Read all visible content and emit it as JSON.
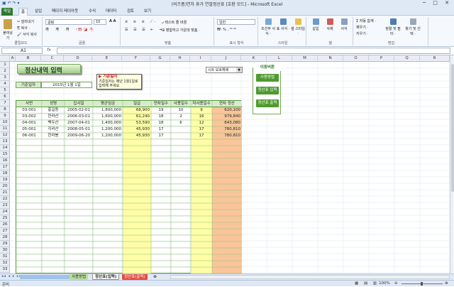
{
  "window": {
    "title": "(비즈폼)연차 휴가 연말정산표  [호환 모드]  -  Microsoft Excel",
    "controls": "─ □ ✕"
  },
  "tabs": [
    {
      "label": "파일"
    },
    {
      "label": "홈"
    },
    {
      "label": "삽입"
    },
    {
      "label": "페이지 레이아웃"
    },
    {
      "label": "수식"
    },
    {
      "label": "데이터"
    },
    {
      "label": "검토"
    },
    {
      "label": "보기"
    }
  ],
  "ribbon": {
    "clipboard": {
      "paste": "붙여넣기",
      "cut": "잘라내기",
      "copy": "복사 ·",
      "format_painter": "서식 복사",
      "label": "클립보드"
    },
    "font": {
      "name": "굴림",
      "size": "10",
      "label": "글꼴"
    },
    "align": {
      "wrap": "텍스트 줄 바꿈",
      "merge": "병합하고 가운데 맞춤 ·",
      "label": "맞춤"
    },
    "number": {
      "format": "일반",
      "label": "표시 형식"
    },
    "styles": {
      "cond": "조건부 서식 ·",
      "table": "표 서식 ·",
      "cell": "셀 스타일 ·",
      "label": "스타일"
    },
    "cells": {
      "insert": "삽입",
      "delete": "삭제",
      "format": "서식",
      "label": "셀"
    },
    "edit": {
      "autosum": "Σ 자동 합계 ·",
      "fill": "채우기 ·",
      "clear": "지우기 ·",
      "sort": "정렬 및 필터 ·",
      "find": "찾기 및 선택 ·",
      "label": "편집"
    }
  },
  "formula_bar": {
    "cell": "A1",
    "fx": "fx",
    "value": ""
  },
  "columns": [
    "A",
    "B",
    "C",
    "D",
    "E",
    "F",
    "G",
    "H",
    "I",
    "J",
    "K",
    "L",
    "M",
    "N",
    "O",
    "P",
    "Q",
    "R"
  ],
  "rows": [
    "1",
    "2",
    "3",
    "4",
    "5",
    "6",
    "7",
    "8",
    "9",
    "10",
    "11",
    "12",
    "13",
    "14",
    "15",
    "16",
    "17",
    "18",
    "19",
    "20",
    "21",
    "22",
    "23",
    "24",
    "25",
    "26",
    "27",
    "28",
    "29",
    "30",
    "31",
    "32",
    "33"
  ],
  "sheet": {
    "title": "정산내역 입력",
    "base_date_label": "기준일자",
    "base_date_value": "2015년 1월 1일",
    "comment_title": "▶ 기준일자",
    "comment_body": "기준일자는 매년 1월1일로 입력해 주세요.",
    "dropdown": "시트 보호해제",
    "panel": {
      "title": "이동버튼",
      "btn1": "사용방법",
      "btn2": "정산표 입력",
      "btn3": "정산표 출력"
    },
    "headers": [
      "사번",
      "성명",
      "입사일",
      "평균임금",
      "일급",
      "연차일수",
      "사용일수",
      "미사용일수",
      "연차 정산"
    ],
    "records": [
      [
        "03-001",
        "홍길동",
        "2005-02-01",
        "1,800,000",
        "68,900",
        "19",
        "10",
        "9",
        "620,100"
      ],
      [
        "03-002",
        "한라산",
        "2006-03-01",
        "1,600,000",
        "61,240",
        "18",
        "2",
        "16",
        "979,840"
      ],
      [
        "04-001",
        "백두산",
        "2007-04-01",
        "1,400,000",
        "53,590",
        "18",
        "6",
        "12",
        "643,080"
      ],
      [
        "05-001",
        "지리산",
        "2008-05-01",
        "1,200,000",
        "45,930",
        "17",
        "",
        "17",
        "780,810"
      ],
      [
        "06-001",
        "한라봉",
        "2009-06-20",
        "1,200,000",
        "45,930",
        "17",
        "",
        "17",
        "780,810"
      ]
    ]
  },
  "sheet_tabs": [
    "사용방법",
    "정산표(입력)",
    "정산표(출력)"
  ],
  "status": {
    "left": "준비",
    "zoom": "100%"
  }
}
